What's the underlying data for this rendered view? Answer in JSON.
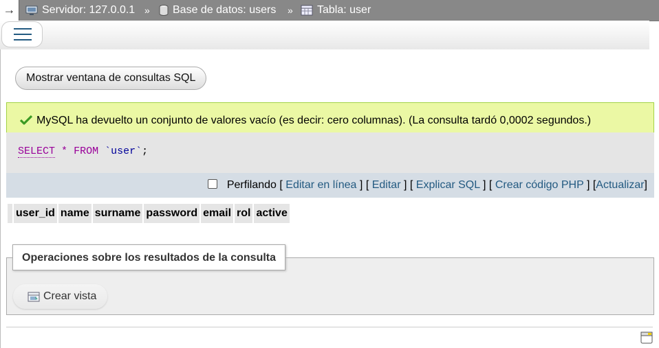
{
  "topbar": {
    "arrow": "→",
    "server": "Servidor: 127.0.0.1",
    "database": "Base de datos: users",
    "table": "Tabla: user",
    "sep": "»"
  },
  "actions": {
    "show_sql_window": "Mostrar ventana de consultas SQL"
  },
  "message": {
    "text": "MySQL ha devuelto un conjunto de valores vacío (es decir: cero columnas). (La consulta tardó 0,0002 segundos.)"
  },
  "sql": {
    "select": "SELECT",
    "star": "*",
    "from": "FROM",
    "table": "`user`",
    "end": ";"
  },
  "links": {
    "profiling": "Perfilando",
    "edit_inline": "Editar en línea",
    "edit": "Editar",
    "explain": "Explicar SQL",
    "php": "Crear código PHP",
    "refresh": "Actualizar",
    "open": "[",
    "close": "]"
  },
  "columns": [
    "user_id",
    "name",
    "surname",
    "password",
    "email",
    "rol",
    "active"
  ],
  "operations": {
    "legend": "Operaciones sobre los resultados de la consulta",
    "create_view": "Crear vista"
  },
  "colors": {
    "topbar": "#888888",
    "success_bg": "#ebf8a4",
    "link": "#235a81",
    "sql_keyword": "#990099"
  }
}
